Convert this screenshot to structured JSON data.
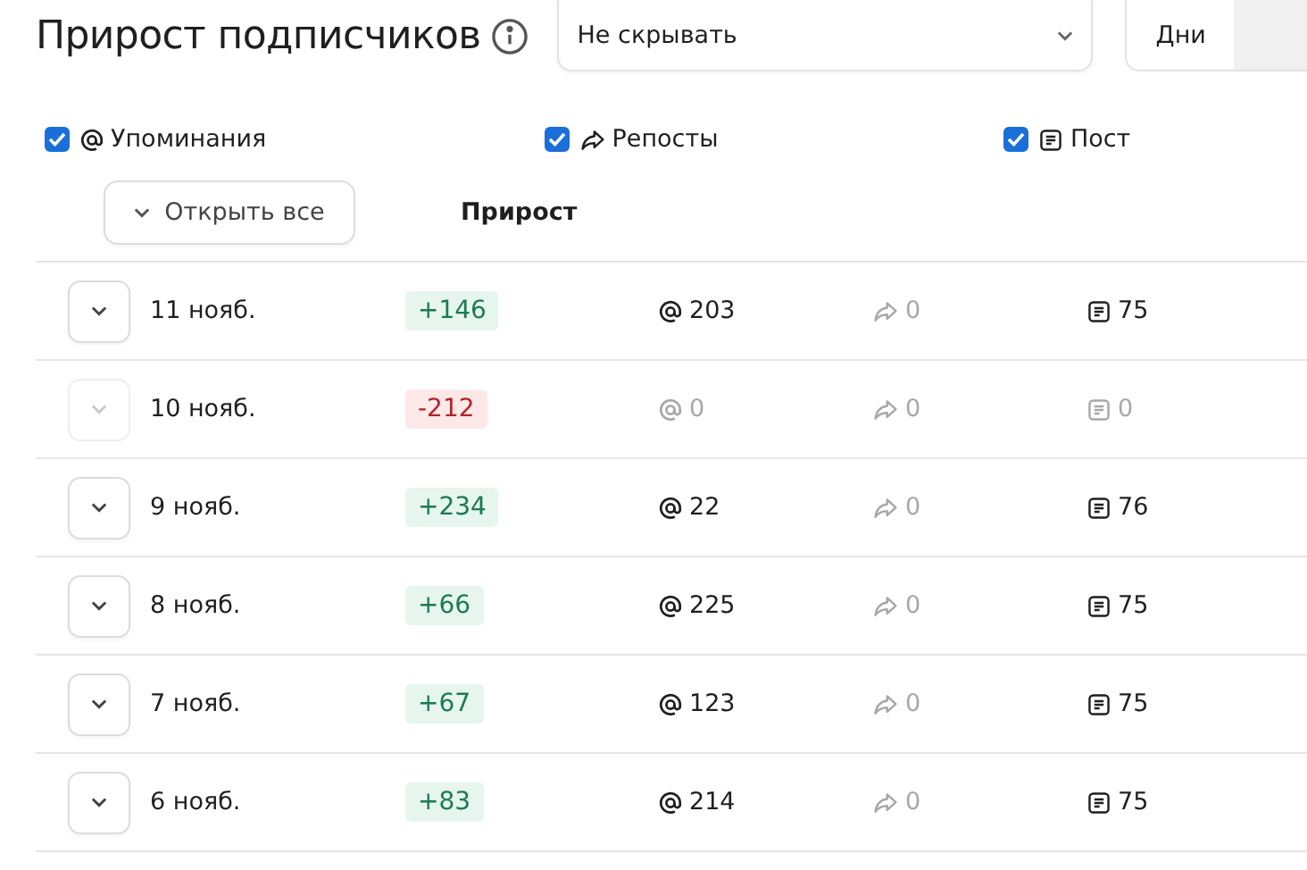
{
  "title": "Прирост подписчиков",
  "filter": {
    "value": "Не скрывать"
  },
  "period_tabs": [
    {
      "label": "Дни",
      "selected": true
    },
    {
      "selected": false
    }
  ],
  "metrics": [
    {
      "kind": "mentions",
      "label": "Упоминания",
      "checked": true
    },
    {
      "kind": "reposts",
      "label": "Репосты",
      "checked": true
    },
    {
      "kind": "posts",
      "label": "Пост",
      "checked": true
    }
  ],
  "expand_all": "Открыть все",
  "columns": [
    "Прирост"
  ],
  "rows": [
    {
      "date": "11 нояб.",
      "disabled": false,
      "growth": "+146",
      "kind": "gain",
      "cells": [
        {
          "kind": "mentions",
          "value": "203",
          "muted": false
        },
        {
          "kind": "reposts",
          "value": "0",
          "muted": true
        },
        {
          "kind": "posts",
          "value": "75",
          "muted": false
        }
      ]
    },
    {
      "date": "10 нояб.",
      "disabled": true,
      "growth": "-212",
      "kind": "loss",
      "cells": [
        {
          "kind": "mentions",
          "value": "0",
          "muted": true
        },
        {
          "kind": "reposts",
          "value": "0",
          "muted": true
        },
        {
          "kind": "posts",
          "value": "0",
          "muted": true
        }
      ]
    },
    {
      "date": "9 нояб.",
      "disabled": false,
      "growth": "+234",
      "kind": "gain",
      "cells": [
        {
          "kind": "mentions",
          "value": "22",
          "muted": false
        },
        {
          "kind": "reposts",
          "value": "0",
          "muted": true
        },
        {
          "kind": "posts",
          "value": "76",
          "muted": false
        }
      ]
    },
    {
      "date": "8 нояб.",
      "disabled": false,
      "growth": "+66",
      "kind": "gain",
      "cells": [
        {
          "kind": "mentions",
          "value": "225",
          "muted": false
        },
        {
          "kind": "reposts",
          "value": "0",
          "muted": true
        },
        {
          "kind": "posts",
          "value": "75",
          "muted": false
        }
      ]
    },
    {
      "date": "7 нояб.",
      "disabled": false,
      "growth": "+67",
      "kind": "gain",
      "cells": [
        {
          "kind": "mentions",
          "value": "123",
          "muted": false
        },
        {
          "kind": "reposts",
          "value": "0",
          "muted": true
        },
        {
          "kind": "posts",
          "value": "75",
          "muted": false
        }
      ]
    },
    {
      "date": "6 нояб.",
      "disabled": false,
      "growth": "+83",
      "kind": "gain",
      "cells": [
        {
          "kind": "mentions",
          "value": "214",
          "muted": false
        },
        {
          "kind": "reposts",
          "value": "0",
          "muted": true
        },
        {
          "kind": "posts",
          "value": "75",
          "muted": false
        }
      ]
    }
  ]
}
